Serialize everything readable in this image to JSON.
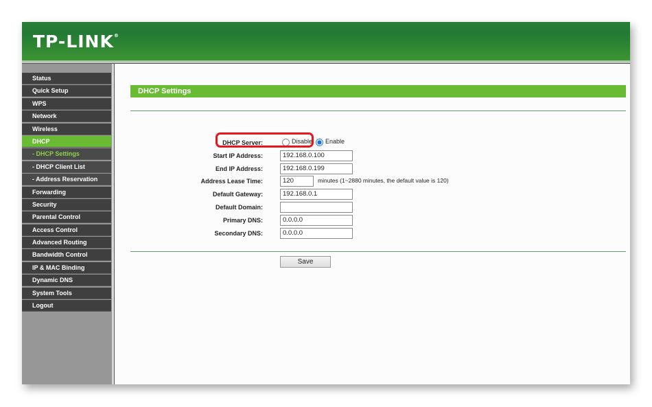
{
  "brand": {
    "logo": "TP-LINK",
    "trademark": "®"
  },
  "sidebar": {
    "items": [
      {
        "label": "Status",
        "type": "main"
      },
      {
        "label": "Quick Setup",
        "type": "main"
      },
      {
        "label": "WPS",
        "type": "main"
      },
      {
        "label": "Network",
        "type": "main"
      },
      {
        "label": "Wireless",
        "type": "main"
      },
      {
        "label": "DHCP",
        "type": "main-active"
      },
      {
        "label": "- DHCP Settings",
        "type": "sub-active"
      },
      {
        "label": "- DHCP Client List",
        "type": "sub"
      },
      {
        "label": "- Address Reservation",
        "type": "sub"
      },
      {
        "label": "Forwarding",
        "type": "main"
      },
      {
        "label": "Security",
        "type": "main"
      },
      {
        "label": "Parental Control",
        "type": "main"
      },
      {
        "label": "Access Control",
        "type": "main"
      },
      {
        "label": "Advanced Routing",
        "type": "main"
      },
      {
        "label": "Bandwidth Control",
        "type": "main"
      },
      {
        "label": "IP & MAC Binding",
        "type": "main"
      },
      {
        "label": "Dynamic DNS",
        "type": "main"
      },
      {
        "label": "System Tools",
        "type": "main"
      },
      {
        "label": "Logout",
        "type": "main"
      }
    ]
  },
  "main": {
    "title": "DHCP Settings",
    "dhcp_server": {
      "label": "DHCP Server:",
      "options": [
        "Disable",
        "Enable"
      ],
      "selected": "Enable"
    },
    "fields": {
      "start_ip": {
        "label": "Start IP Address:",
        "value": "192.168.0.100"
      },
      "end_ip": {
        "label": "End IP Address:",
        "value": "192.168.0.199"
      },
      "lease_time": {
        "label": "Address Lease Time:",
        "value": "120",
        "hint": "minutes (1~2880 minutes, the default value is 120)"
      },
      "gateway": {
        "label": "Default Gateway:",
        "value": "192.168.0.1"
      },
      "domain": {
        "label": "Default Domain:",
        "value": ""
      },
      "primary_dns": {
        "label": "Primary DNS:",
        "value": "0.0.0.0"
      },
      "secondary_dns": {
        "label": "Secondary DNS:",
        "value": "0.0.0.0"
      }
    },
    "save_label": "Save"
  },
  "colors": {
    "header_green": "#2a7e3a",
    "accent_green": "#6abb34",
    "sidebar_item": "#3f3f3f",
    "highlight_red": "#e5171b",
    "radio_blue": "#1a6fe0"
  }
}
